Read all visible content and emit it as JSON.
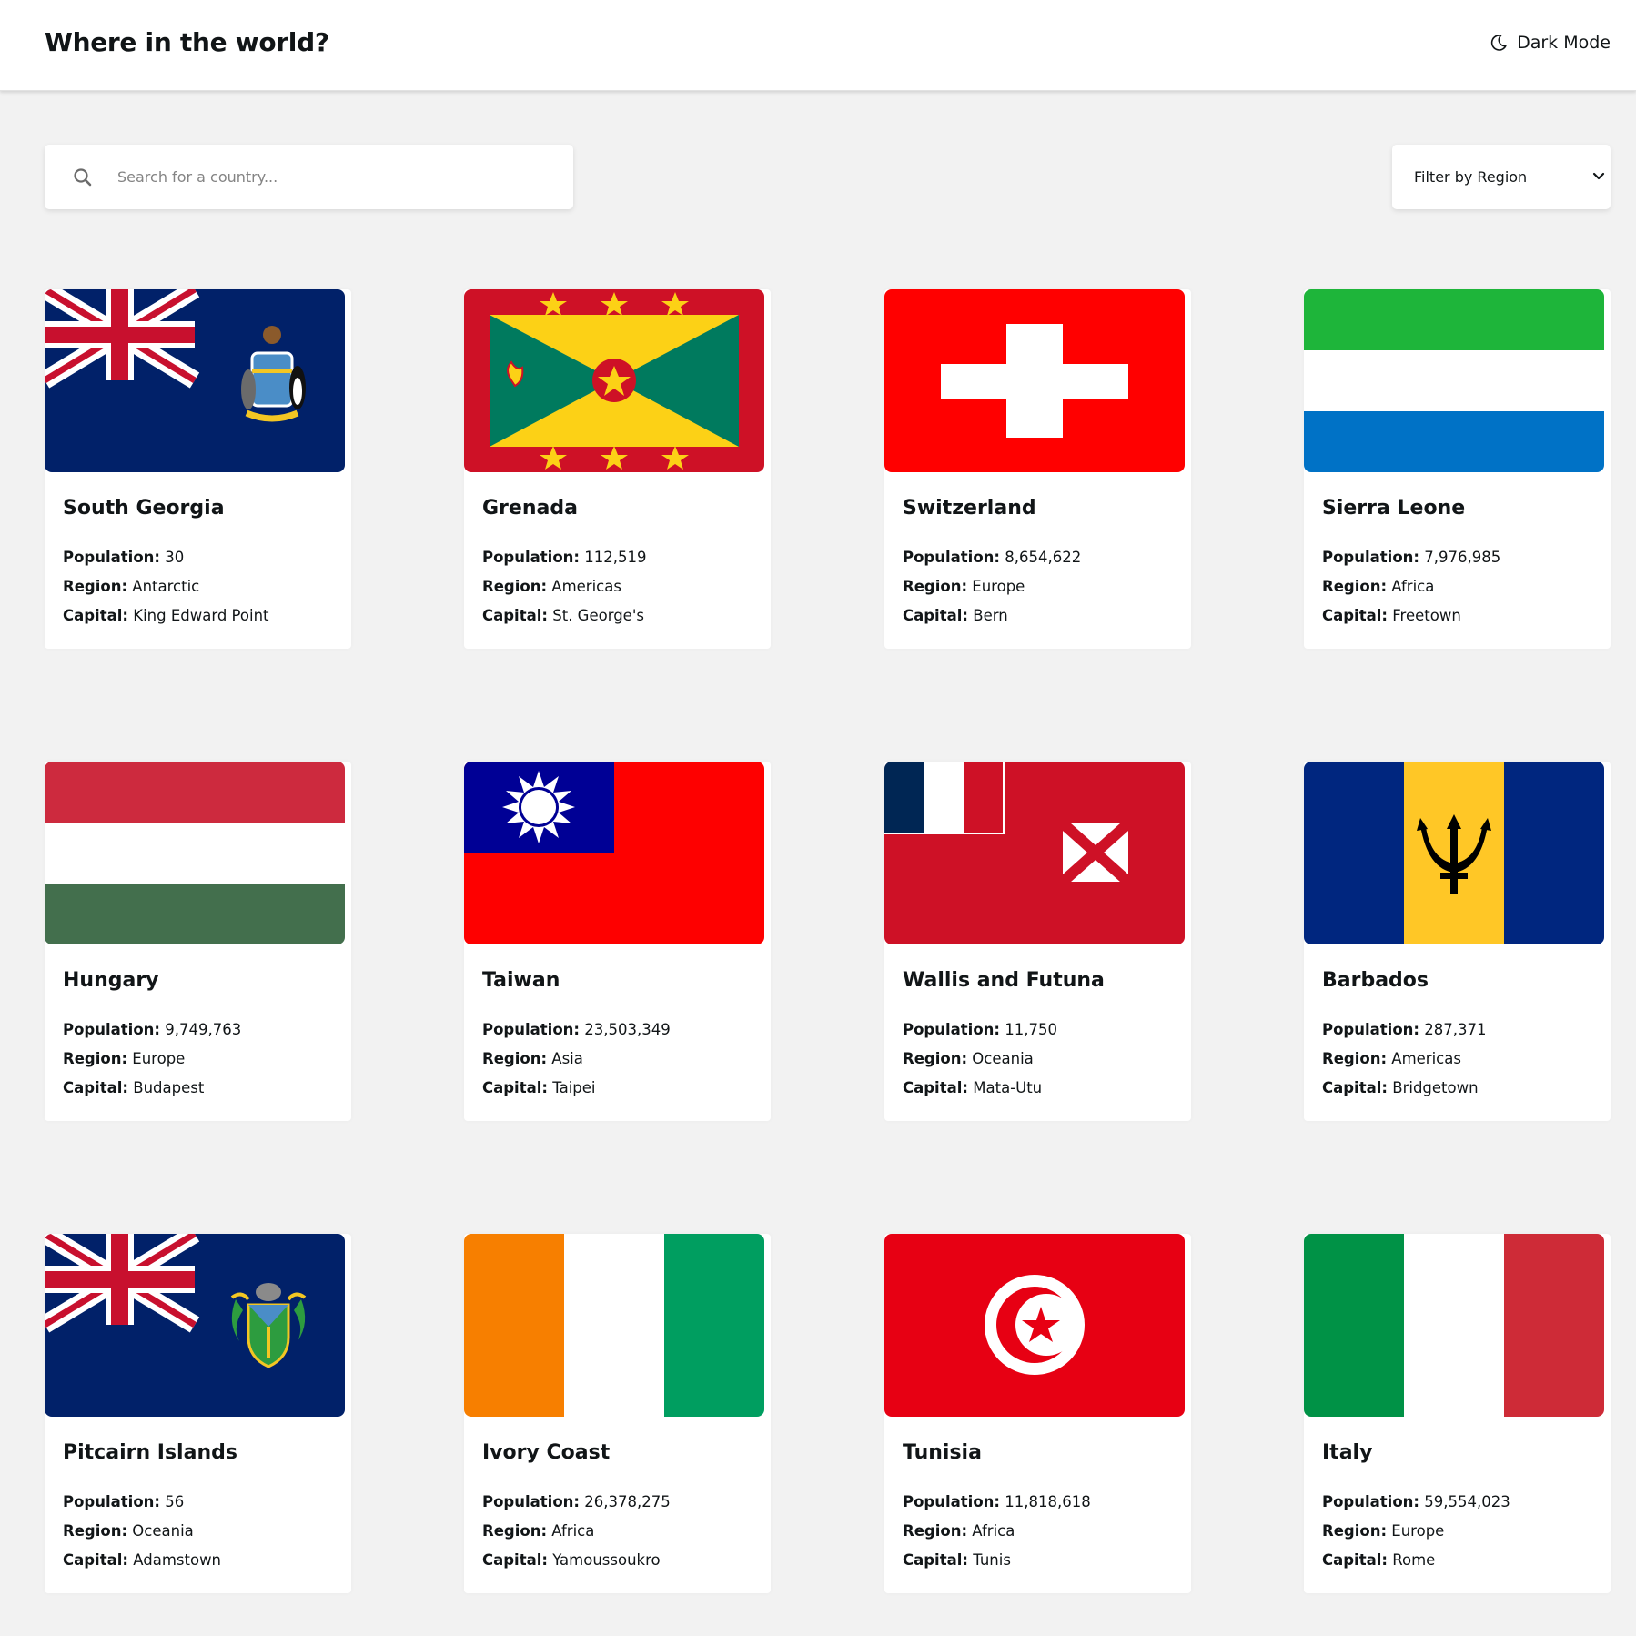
{
  "header": {
    "title": "Where in the world?",
    "dark_mode_label": "Dark Mode"
  },
  "search": {
    "placeholder": "Search for a country..."
  },
  "filter": {
    "label": "Filter by Region"
  },
  "labels": {
    "population": "Population:",
    "region": "Region:",
    "capital": "Capital:"
  },
  "countries": [
    {
      "name": "South Georgia",
      "population": "30",
      "region": "Antarctic",
      "capital": "King Edward Point"
    },
    {
      "name": "Grenada",
      "population": "112,519",
      "region": "Americas",
      "capital": "St. George's"
    },
    {
      "name": "Switzerland",
      "population": "8,654,622",
      "region": "Europe",
      "capital": "Bern"
    },
    {
      "name": "Sierra Leone",
      "population": "7,976,985",
      "region": "Africa",
      "capital": "Freetown"
    },
    {
      "name": "Hungary",
      "population": "9,749,763",
      "region": "Europe",
      "capital": "Budapest"
    },
    {
      "name": "Taiwan",
      "population": "23,503,349",
      "region": "Asia",
      "capital": "Taipei"
    },
    {
      "name": "Wallis and Futuna",
      "population": "11,750",
      "region": "Oceania",
      "capital": "Mata-Utu"
    },
    {
      "name": "Barbados",
      "population": "287,371",
      "region": "Americas",
      "capital": "Bridgetown"
    },
    {
      "name": "Pitcairn Islands",
      "population": "56",
      "region": "Oceania",
      "capital": "Adamstown"
    },
    {
      "name": "Ivory Coast",
      "population": "26,378,275",
      "region": "Africa",
      "capital": "Yamoussoukro"
    },
    {
      "name": "Tunisia",
      "population": "11,818,618",
      "region": "Africa",
      "capital": "Tunis"
    },
    {
      "name": "Italy",
      "population": "59,554,023",
      "region": "Europe",
      "capital": "Rome"
    }
  ],
  "colors": {
    "background": "#f2f2f2",
    "card": "#ffffff",
    "text": "#111517"
  }
}
